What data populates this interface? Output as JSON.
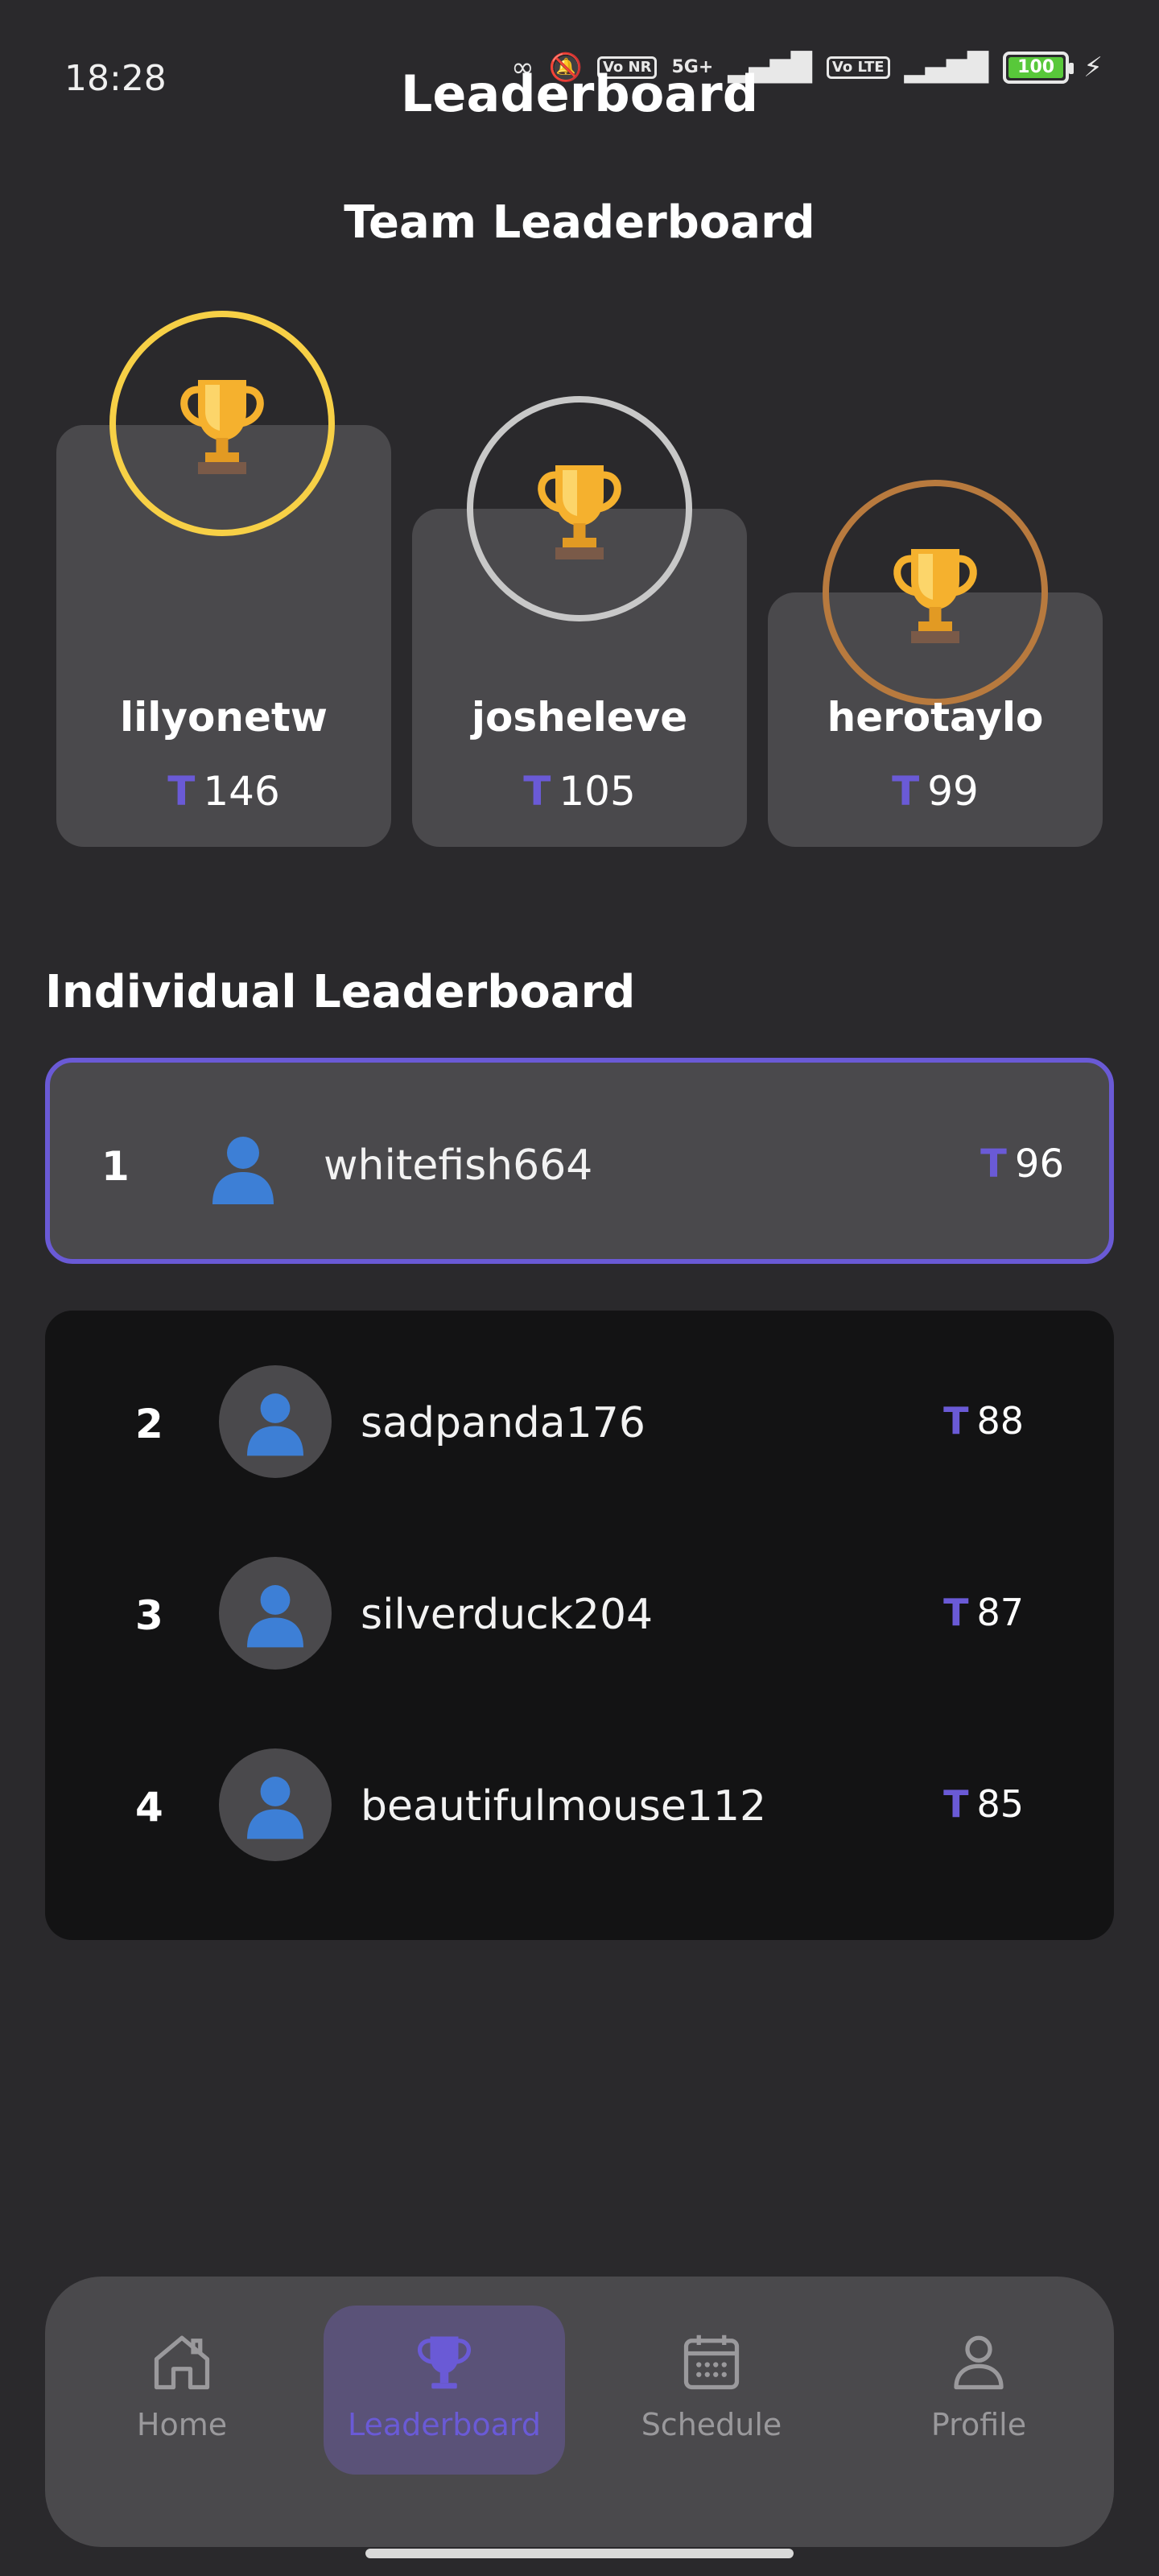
{
  "status_bar": {
    "time": "18:28",
    "network_label": "5G+",
    "volte_label_1": "Vo NR",
    "volte_label_2": "Vo LTE",
    "battery_level": "100"
  },
  "header": {
    "title": "Leaderboard"
  },
  "team_section": {
    "title": "Team Leaderboard",
    "teams": [
      {
        "name": "lilyonetw",
        "score": "146",
        "ring_color": "#f7d046"
      },
      {
        "name": "josheleve",
        "score": "105",
        "ring_color": "#c8c8c8"
      },
      {
        "name": "herotaylo",
        "score": "99",
        "ring_color": "#b87a3e"
      }
    ]
  },
  "individual_section": {
    "title": "Individual Leaderboard",
    "top": {
      "rank": "1",
      "username": "whitefish664",
      "score": "96"
    },
    "rows": [
      {
        "rank": "2",
        "username": "sadpanda176",
        "score": "88"
      },
      {
        "rank": "3",
        "username": "silverduck204",
        "score": "87"
      },
      {
        "rank": "4",
        "username": "beautifulmouse112",
        "score": "85"
      }
    ]
  },
  "token_symbol": "T",
  "nav": {
    "items": [
      {
        "label": "Home",
        "icon": "home-icon"
      },
      {
        "label": "Leaderboard",
        "icon": "trophy-icon"
      },
      {
        "label": "Schedule",
        "icon": "calendar-icon"
      },
      {
        "label": "Profile",
        "icon": "person-icon"
      }
    ],
    "active": "Leaderboard"
  },
  "colors": {
    "background": "#2a292c",
    "card": "#4a494c",
    "accent": "#6a5ad6",
    "panel": "#131314"
  }
}
